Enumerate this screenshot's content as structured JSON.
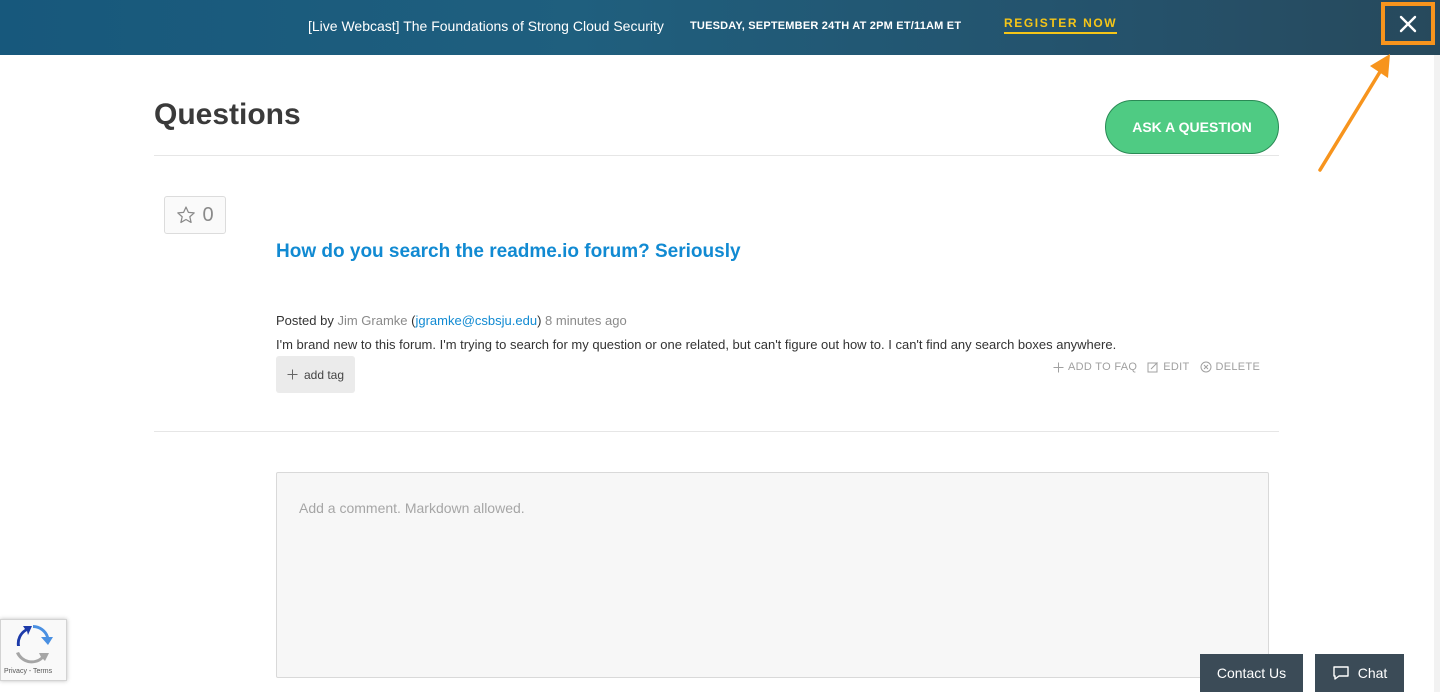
{
  "banner": {
    "title": "[Live Webcast] The Foundations of Strong Cloud Security",
    "date": "TUESDAY, SEPTEMBER 24TH AT 2PM ET/11AM ET",
    "register_label": "REGISTER NOW",
    "close_icon": "close-icon",
    "highlight_color": "#f7941d"
  },
  "page": {
    "title": "Questions",
    "ask_button": "ASK A QUESTION"
  },
  "question": {
    "votes": "0",
    "title": "How do you search the readme.io forum? Seriously",
    "posted_by_label": "Posted by",
    "author": "Jim Gramke",
    "paren_open": "(",
    "email": "jgramke@csbsju.edu",
    "paren_close": ")",
    "time": "8 minutes ago",
    "body": "I'm brand new to this forum. I'm trying to search for my question or one related, but can't figure out how to. I can't find any search boxes anywhere.",
    "add_tag": "add tag",
    "actions": {
      "add_to_faq": "ADD TO FAQ",
      "edit": "EDIT",
      "delete": "DELETE"
    }
  },
  "comment": {
    "placeholder": "Add a comment. Markdown allowed."
  },
  "recaptcha": {
    "terms": "Privacy - Terms"
  },
  "footer": {
    "contact": "Contact Us",
    "chat": "Chat"
  },
  "colors": {
    "accent_green": "#4fcb83",
    "link_blue": "#118ad2",
    "register_yellow": "#f5c518"
  }
}
